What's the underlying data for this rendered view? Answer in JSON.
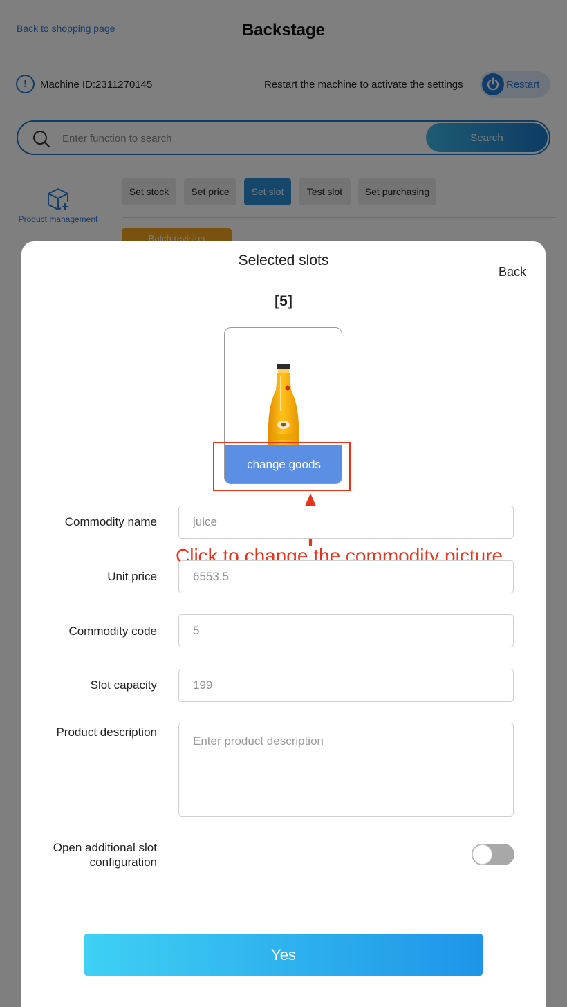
{
  "header": {
    "back_link": "Back to shopping page",
    "title": "Backstage"
  },
  "machine": {
    "id_text": "Machine ID:2311270145",
    "restart_hint": "Restart the machine to activate the settings",
    "restart_label": "Restart"
  },
  "search": {
    "placeholder": "Enter function to search",
    "button_label": "Search"
  },
  "sidebar": {
    "product_management": "Product management"
  },
  "tabs": [
    {
      "label": "Set stock",
      "active": false
    },
    {
      "label": "Set price",
      "active": false
    },
    {
      "label": "Set slot",
      "active": true
    },
    {
      "label": "Test slot",
      "active": false
    },
    {
      "label": "Set purchasing",
      "active": false
    }
  ],
  "batch_button": "Batch revision",
  "dialog": {
    "title": "Selected slots",
    "back_label": "Back",
    "slot_label": "[5]",
    "change_goods_label": "change goods",
    "annotation": "Click to change the commodity picture",
    "fields": {
      "commodity_name": {
        "label": "Commodity name",
        "value": "juice"
      },
      "unit_price": {
        "label": "Unit price",
        "value": "6553.5"
      },
      "commodity_code": {
        "label": "Commodity code",
        "value": "5"
      },
      "slot_capacity": {
        "label": "Slot capacity",
        "value": "199"
      },
      "product_description": {
        "label": "Product description",
        "placeholder": "Enter product description"
      },
      "additional_slot": {
        "label_line1": "Open additional slot",
        "label_line2": "configuration",
        "enabled": false
      }
    },
    "confirm_label": "Yes"
  },
  "colors": {
    "accent": "#2a7ad6",
    "active_tab": "#2b8fd6",
    "change_goods": "#5b8fe4",
    "annotation": "#e8341c",
    "batch": "#f2a51e"
  }
}
